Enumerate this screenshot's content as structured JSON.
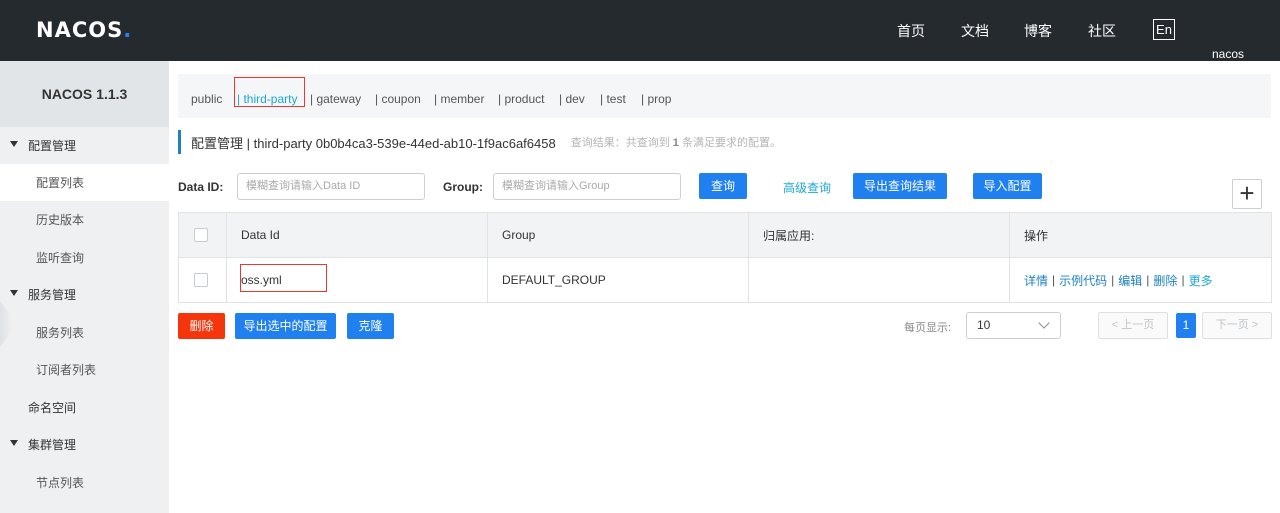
{
  "header": {
    "logo": "NACOS",
    "logo_dot": ".",
    "nav": [
      "首页",
      "文档",
      "博客",
      "社区"
    ],
    "lang_button": "En",
    "user": "nacos"
  },
  "sidebar": {
    "title": "NACOS 1.1.3",
    "items": [
      {
        "label": "配置管理",
        "type": "group"
      },
      {
        "label": "配置列表",
        "type": "sub",
        "active": true
      },
      {
        "label": "历史版本",
        "type": "sub"
      },
      {
        "label": "监听查询",
        "type": "sub"
      },
      {
        "label": "服务管理",
        "type": "group"
      },
      {
        "label": "服务列表",
        "type": "sub"
      },
      {
        "label": "订阅者列表",
        "type": "sub"
      },
      {
        "label": "命名空间",
        "type": "plain"
      },
      {
        "label": "集群管理",
        "type": "group"
      },
      {
        "label": "节点列表",
        "type": "sub"
      }
    ]
  },
  "namespaces": [
    "public",
    "| third-party",
    "| gateway",
    "| coupon",
    "| member",
    "| product",
    "| dev",
    "| test",
    "| prop"
  ],
  "active_namespace": "third-party",
  "page_title": {
    "text": "配置管理  |  third-party  0b0b4ca3-539e-44ed-ab10-1f9ac6af6458",
    "hint_prefix": "查询结果：共查询到",
    "hint_count": "1",
    "hint_suffix": "条满足要求的配置。"
  },
  "filter": {
    "data_id_label": "Data ID:",
    "data_id_placeholder": "模糊查询请输入Data ID",
    "group_label": "Group:",
    "group_placeholder": "模糊查询请输入Group",
    "query_button": "查询",
    "advanced_link": "高级查询",
    "export_button": "导出查询结果",
    "import_button": "导入配置",
    "add_button": "+"
  },
  "table": {
    "columns": [
      "Data Id",
      "Group",
      "归属应用:",
      "操作"
    ],
    "rows": [
      {
        "data_id": "oss.yml",
        "group": "DEFAULT_GROUP",
        "app": "",
        "ops": [
          "详情",
          "示例代码",
          "编辑",
          "删除"
        ],
        "more": "更多"
      }
    ]
  },
  "bottom": {
    "delete_button": "删除",
    "export_selected_button": "导出选中的配置",
    "clone_button": "克隆",
    "page_size_label": "每页显示:",
    "page_size_value": "10",
    "prev_button": "< 上一页",
    "current_page": "1",
    "next_button": "下一页 >"
  },
  "colors": {
    "topbar": "#252a2f",
    "primary": "#2080f0",
    "danger": "#f5350c",
    "link": "#1ea7d8",
    "highlight_box": "#e53935"
  }
}
